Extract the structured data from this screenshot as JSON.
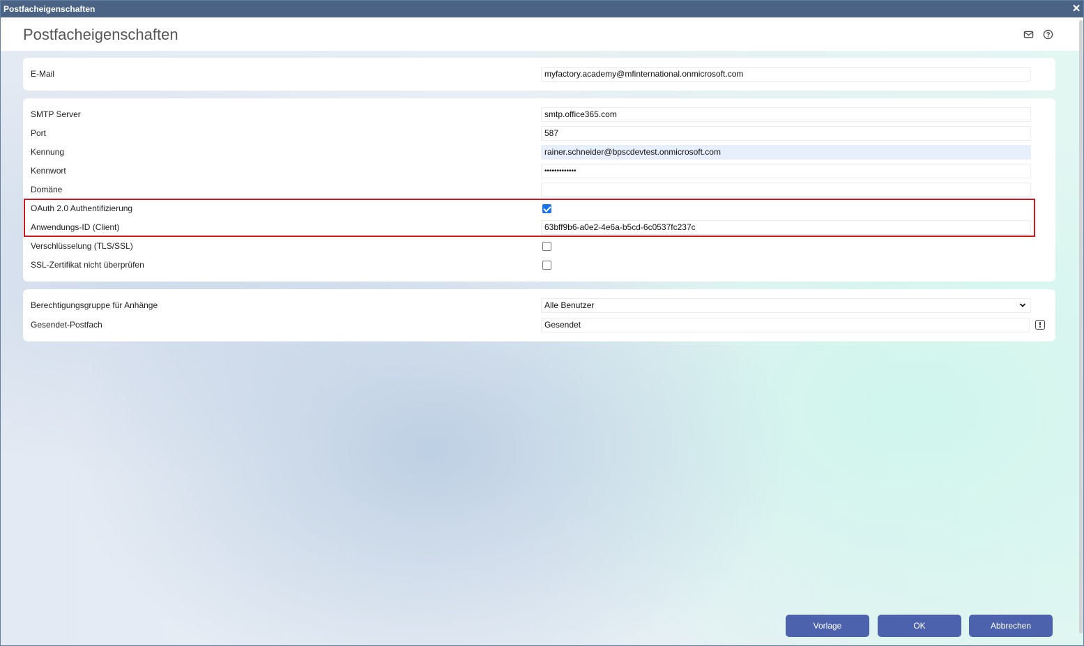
{
  "window": {
    "title": "Postfacheigenschaften",
    "close_glyph": "✕"
  },
  "header": {
    "title": "Postfacheigenschaften",
    "icons": [
      "mail-icon",
      "help-icon"
    ]
  },
  "email_section": {
    "email_label": "E-Mail",
    "email_value": "myfactory.academy@mfinternational.onmicrosoft.com"
  },
  "smtp_section": {
    "server_label": "SMTP Server",
    "server_value": "smtp.office365.com",
    "port_label": "Port",
    "port_value": "587",
    "user_label": "Kennung",
    "user_value": "rainer.schneider@bpscdevtest.onmicrosoft.com",
    "password_label": "Kennwort",
    "password_value": "•••••••••••••",
    "domain_label": "Domäne",
    "domain_value": "",
    "oauth_label": "OAuth 2.0 Authentifizierung",
    "oauth_checked": true,
    "client_id_label": "Anwendungs-ID (Client)",
    "client_id_value": "63bff9b6-a0e2-4e6a-b5cd-6c0537fc237c",
    "encryption_label": "Verschlüsselung (TLS/SSL)",
    "encryption_checked": false,
    "ssl_check_label": "SSL-Zertifikat nicht überprüfen",
    "ssl_check_checked": false
  },
  "attachments_section": {
    "permission_label": "Berechtigungsgruppe für Anhänge",
    "permission_value": "Alle Benutzer",
    "sent_label": "Gesendet-Postfach",
    "sent_value": "Gesendet"
  },
  "footer": {
    "template_label": "Vorlage",
    "ok_label": "OK",
    "cancel_label": "Abbrechen"
  },
  "colors": {
    "titlebar": "#4b6485",
    "button": "#4d62ad",
    "highlight_border": "#d0161d",
    "checkbox_checked": "#1a73e8"
  }
}
